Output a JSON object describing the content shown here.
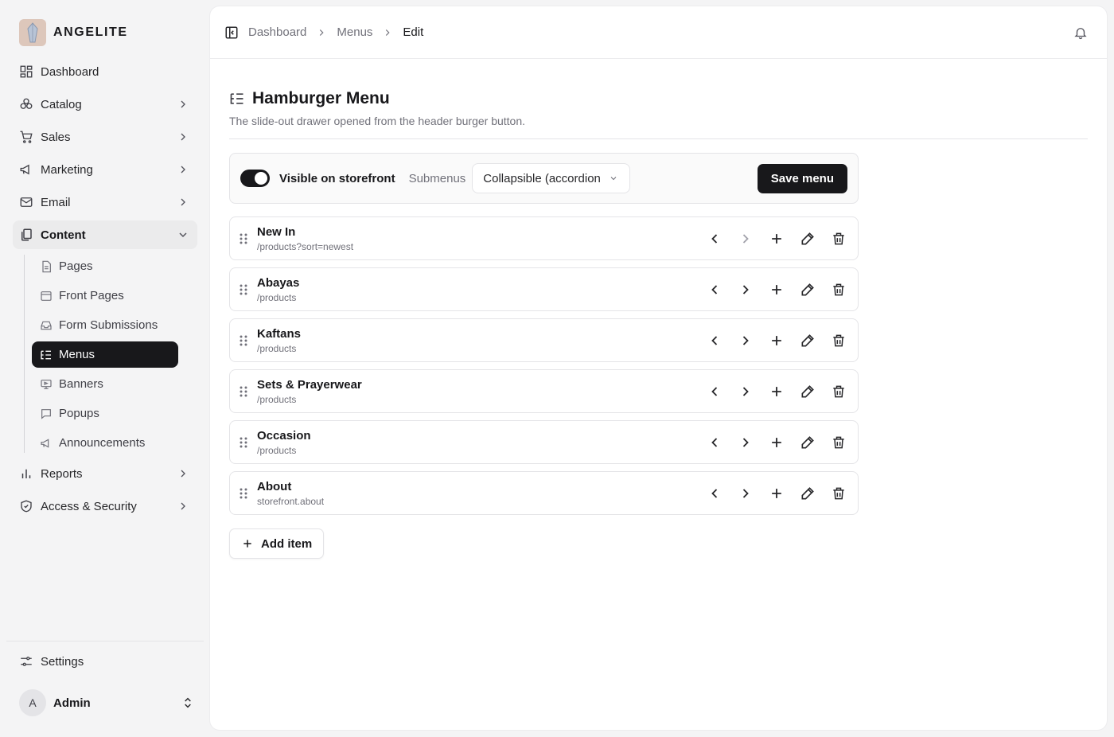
{
  "brand": {
    "name": "ANGELITE"
  },
  "sidebar": {
    "items": [
      {
        "label": "Dashboard",
        "icon": "dashboard-icon"
      },
      {
        "label": "Catalog",
        "icon": "catalog-icon"
      },
      {
        "label": "Sales",
        "icon": "cart-icon"
      },
      {
        "label": "Marketing",
        "icon": "megaphone-icon"
      },
      {
        "label": "Email",
        "icon": "mail-icon"
      },
      {
        "label": "Content",
        "icon": "content-icon",
        "expanded": true
      },
      {
        "label": "Reports",
        "icon": "reports-icon"
      },
      {
        "label": "Access & Security",
        "icon": "shield-icon"
      }
    ],
    "content_children": [
      {
        "label": "Pages",
        "icon": "page-icon"
      },
      {
        "label": "Front Pages",
        "icon": "front-page-icon"
      },
      {
        "label": "Form Submissions",
        "icon": "inbox-icon"
      },
      {
        "label": "Menus",
        "icon": "menu-list-icon",
        "active": true
      },
      {
        "label": "Banners",
        "icon": "banner-icon"
      },
      {
        "label": "Popups",
        "icon": "popup-icon"
      },
      {
        "label": "Announcements",
        "icon": "megaphone-icon"
      }
    ],
    "settings_label": "Settings",
    "user": {
      "initial": "A",
      "name": "Admin"
    }
  },
  "breadcrumb": {
    "items": [
      "Dashboard",
      "Menus"
    ],
    "current": "Edit"
  },
  "page": {
    "title": "Hamburger Menu",
    "description": "The slide-out drawer opened from the header burger button."
  },
  "toolbar": {
    "visible_label": "Visible on storefront",
    "visible_on": true,
    "submenus_label": "Submenus",
    "submenus_value": "Collapsible (accordion",
    "save_label": "Save menu"
  },
  "menu_items": [
    {
      "label": "New In",
      "url": "/products?sort=newest",
      "indent_disabled": true
    },
    {
      "label": "Abayas",
      "url": "/products",
      "indent_disabled": false
    },
    {
      "label": "Kaftans",
      "url": "/products",
      "indent_disabled": false
    },
    {
      "label": "Sets & Prayerwear",
      "url": "/products",
      "indent_disabled": false
    },
    {
      "label": "Occasion",
      "url": "/products",
      "indent_disabled": false
    },
    {
      "label": "About",
      "url": "storefront.about",
      "indent_disabled": false
    }
  ],
  "add_item_label": "Add item",
  "colors": {
    "accent": "#18181b",
    "muted": "#71717a",
    "border": "#e4e4e7",
    "background": "#f4f4f5"
  }
}
